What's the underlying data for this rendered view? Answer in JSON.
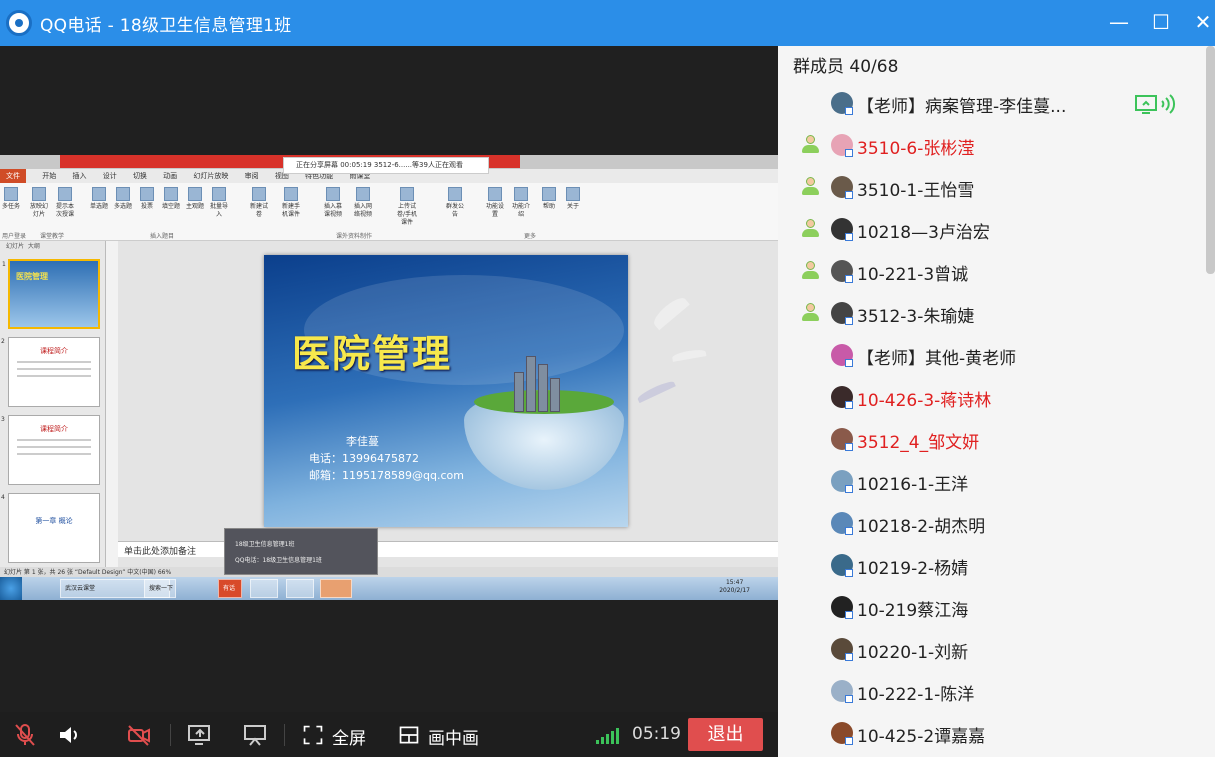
{
  "window": {
    "title": "QQ电话 - 18级卫生信息管理1班",
    "minimize": "—",
    "maximize": "☐",
    "close": "✕"
  },
  "share": {
    "float_banner": "正在分享屏幕 00:05:19 3512-6......等39人正在观看",
    "ppt_tabs": [
      "文件",
      "开始",
      "插入",
      "设计",
      "切换",
      "动画",
      "幻灯片放映",
      "审阅",
      "视图",
      "特色功能",
      "雨课堂"
    ],
    "ribbon_buttons": [
      "多任务",
      "放映幻灯片",
      "提示本次授课",
      "单选题",
      "多选题",
      "投票",
      "填空题",
      "主观题",
      "批量导入",
      "新建试卷",
      "新建手机课件",
      "插入慕课视频",
      "插入网络视频",
      "上传试卷/手机课件",
      "群发公告",
      "功能设置",
      "功能介绍",
      "帮助",
      "关于"
    ],
    "ribbon_groups": [
      "用户登录",
      "课堂教学",
      "插入题目",
      "课外资料制作",
      "更多"
    ],
    "panel_tabs": [
      "幻灯片",
      "大纲"
    ],
    "thumbnails": [
      {
        "num": "1",
        "text": "医院管理"
      },
      {
        "num": "2",
        "text": "课程简介"
      },
      {
        "num": "3",
        "text": "课程简介"
      },
      {
        "num": "4",
        "text": "第一章 概论"
      }
    ],
    "slide": {
      "title": "医院管理",
      "name": "李佳蔓",
      "phone": "电话：13996475872",
      "email": "邮箱：1195178589@qq.com"
    },
    "notes_placeholder": "单击此处添加备注",
    "status_bar": "幻灯片 第 1 张，共 26 张 “Default Design” 中文(中国) 66%",
    "taskbar": {
      "items": [
        "武汉云课堂",
        "搜索一下",
        "有话",
        "18级卫生信息管理1班",
        "QQ电话"
      ],
      "time": "15:47",
      "date": "2020/2/17"
    },
    "qq_tip": [
      "18级卫生信息管理1班",
      "QQ电话：18级卫生信息管理1班"
    ]
  },
  "controls": {
    "fullscreen_label": "全屏",
    "pip_label": "画中画",
    "timer": "05:19",
    "exit_label": "退出"
  },
  "members": {
    "header": "群成员 40/68",
    "list": [
      {
        "name": "【老师】病案管理-李佳蔓...",
        "red": false,
        "speaking": true,
        "user_icon": false,
        "avatar_color": "#4a6e8a"
      },
      {
        "name": "3510-6-张彬滢",
        "red": true,
        "speaking": false,
        "user_icon": true,
        "avatar_color": "#e7a3b5"
      },
      {
        "name": "3510-1-王怡雪",
        "red": false,
        "speaking": false,
        "user_icon": true,
        "avatar_color": "#6a5a4a"
      },
      {
        "name": "10218—3卢治宏",
        "red": false,
        "speaking": false,
        "user_icon": true,
        "avatar_color": "#333333"
      },
      {
        "name": "10-221-3曾诚",
        "red": false,
        "speaking": false,
        "user_icon": true,
        "avatar_color": "#555555"
      },
      {
        "name": "3512-3-朱瑜婕",
        "red": false,
        "speaking": false,
        "user_icon": true,
        "avatar_color": "#444444"
      },
      {
        "name": "【老师】其他-黄老师",
        "red": false,
        "speaking": false,
        "user_icon": false,
        "avatar_color": "#c85aa8"
      },
      {
        "name": "10-426-3-蒋诗林",
        "red": true,
        "speaking": false,
        "user_icon": false,
        "avatar_color": "#3a2a2a"
      },
      {
        "name": "3512_4_邹文妍",
        "red": true,
        "speaking": false,
        "user_icon": false,
        "avatar_color": "#8a5a4a"
      },
      {
        "name": "10216-1-王洋",
        "red": false,
        "speaking": false,
        "user_icon": false,
        "avatar_color": "#7aa0c0"
      },
      {
        "name": "10218-2-胡杰明",
        "red": false,
        "speaking": false,
        "user_icon": false,
        "avatar_color": "#5a88b8"
      },
      {
        "name": "10219-2-杨婧",
        "red": false,
        "speaking": false,
        "user_icon": false,
        "avatar_color": "#3a6a8a"
      },
      {
        "name": "10-219蔡江海",
        "red": false,
        "speaking": false,
        "user_icon": false,
        "avatar_color": "#222222"
      },
      {
        "name": "10220-1-刘新",
        "red": false,
        "speaking": false,
        "user_icon": false,
        "avatar_color": "#5a4a3a"
      },
      {
        "name": "10-222-1-陈洋",
        "red": false,
        "speaking": false,
        "user_icon": false,
        "avatar_color": "#9ab0c8"
      },
      {
        "name": "10-425-2谭嘉嘉",
        "red": false,
        "speaking": false,
        "user_icon": false,
        "avatar_color": "#8a4a2a"
      }
    ]
  }
}
